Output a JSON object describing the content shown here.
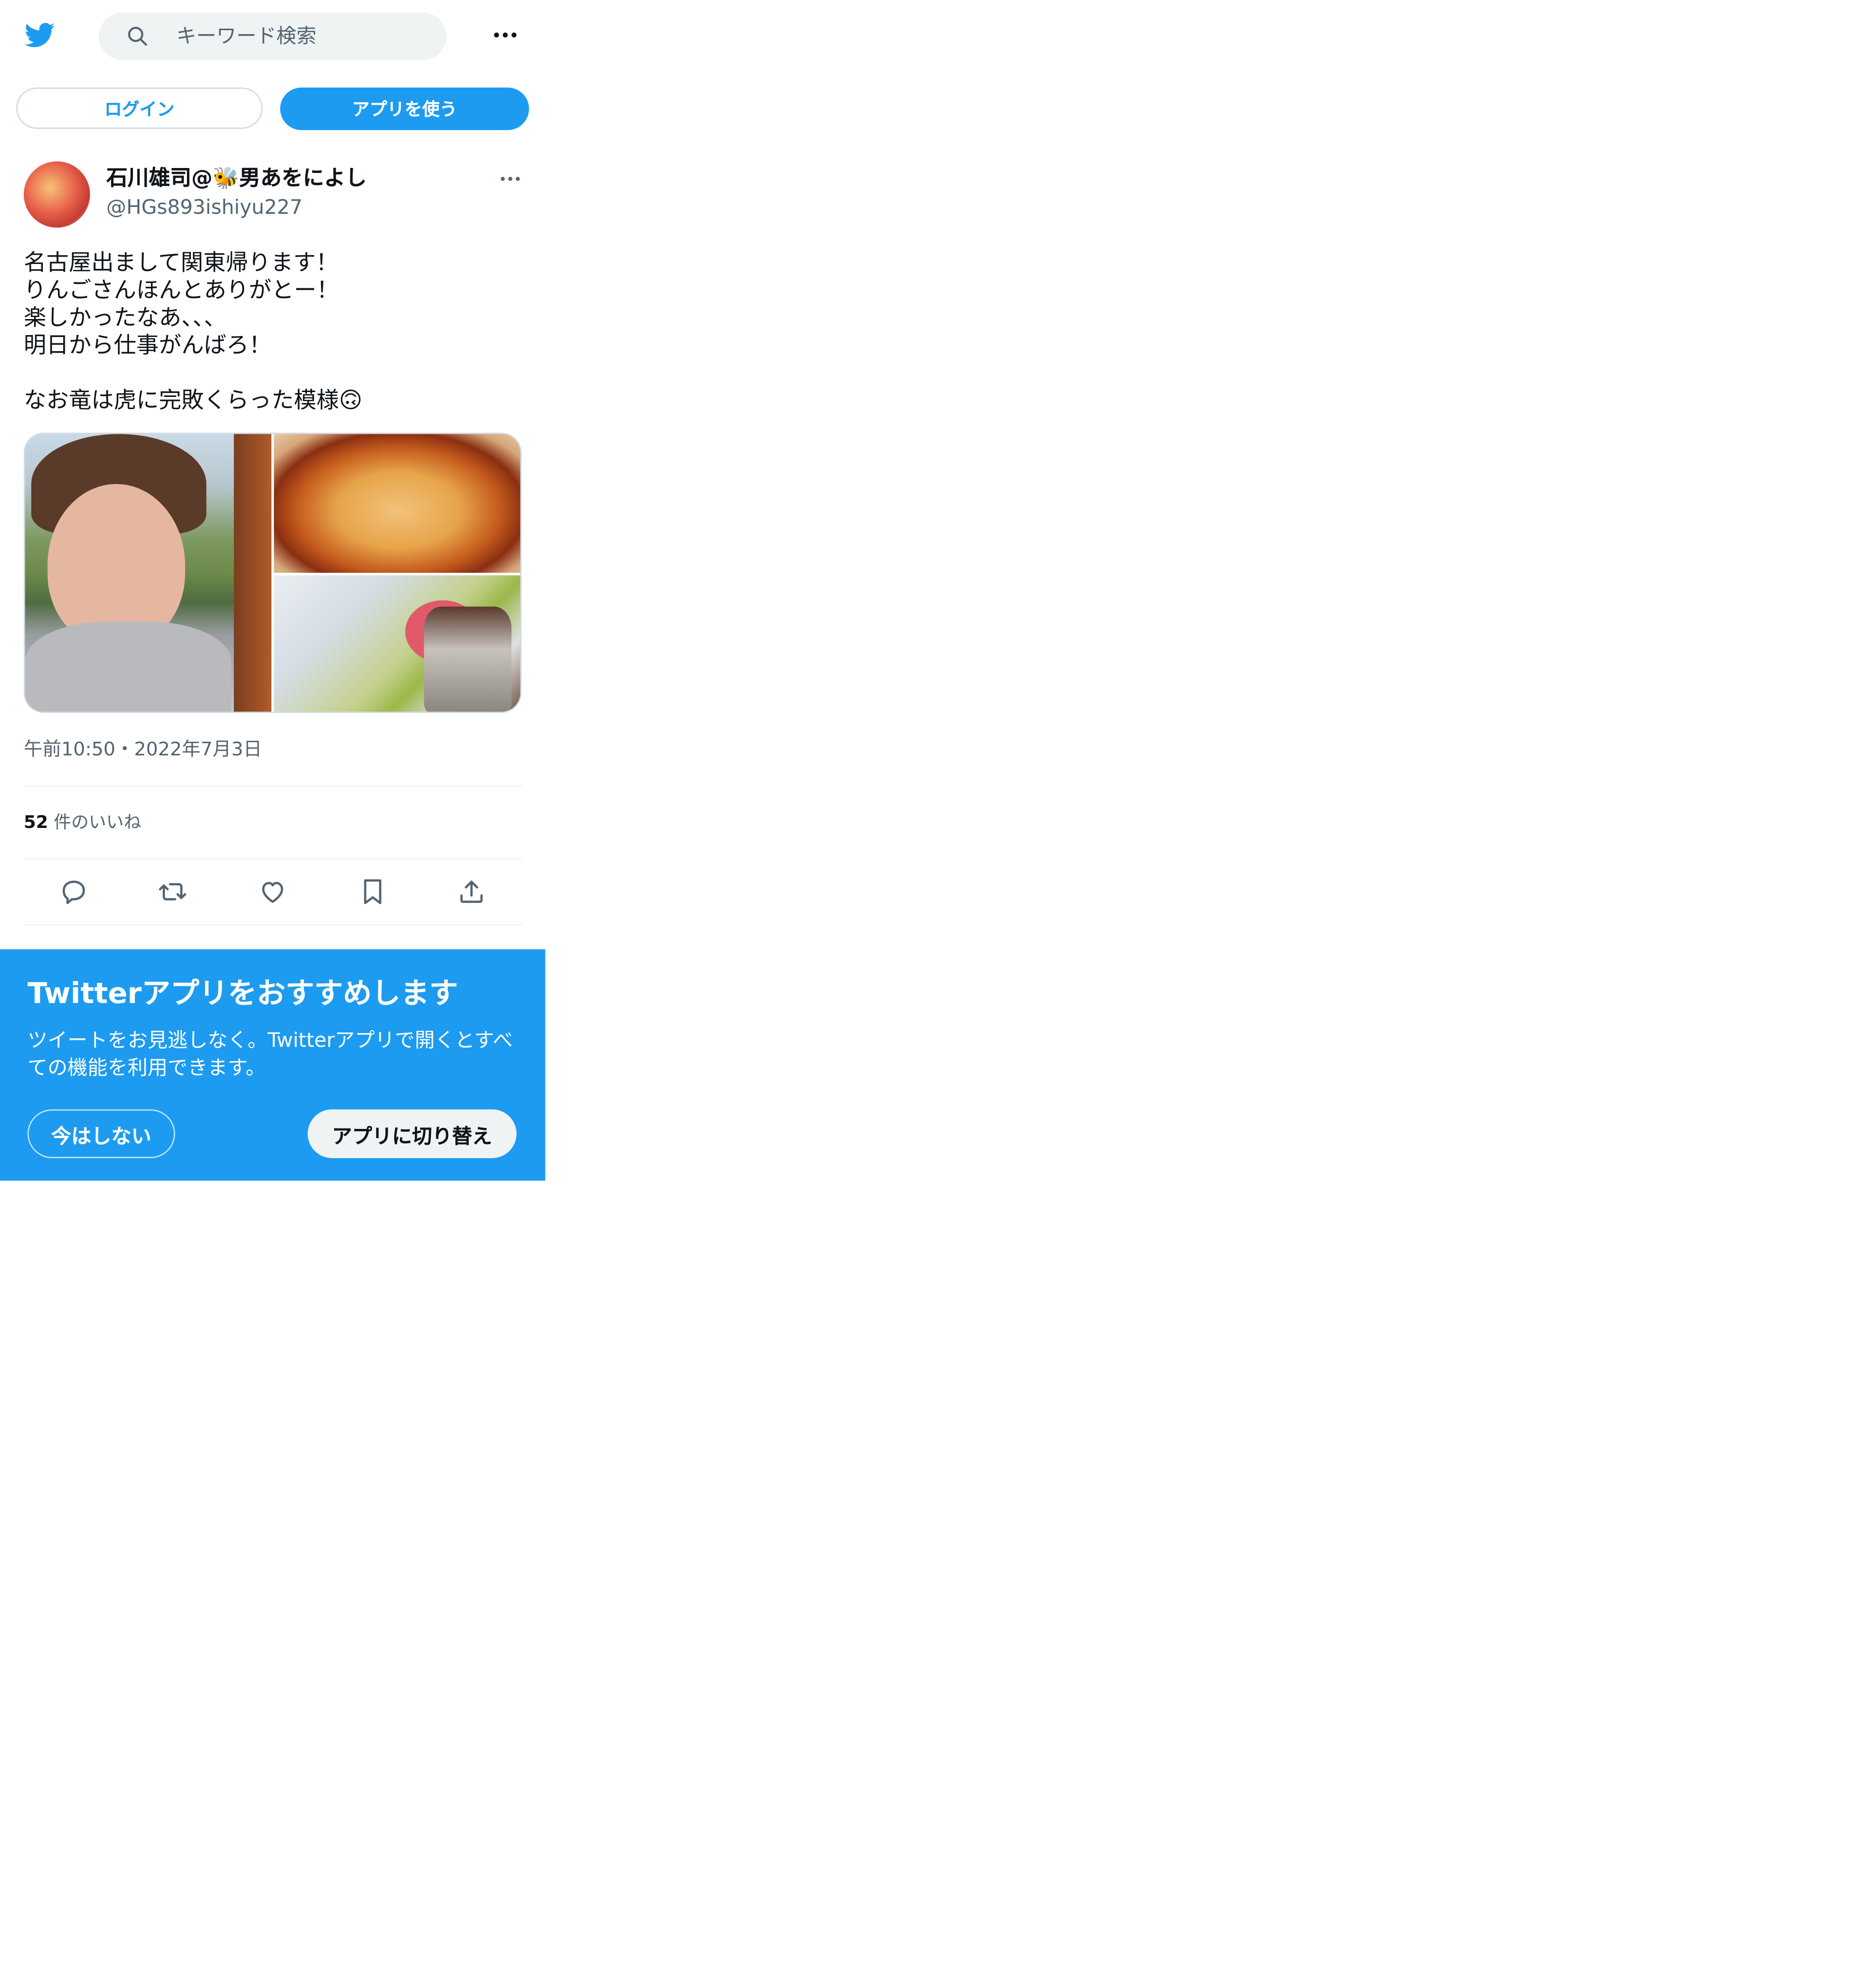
{
  "header": {
    "logo_icon": "twitter-bird-icon",
    "search_placeholder": "キーワード検索",
    "search_icon": "search-icon",
    "more_icon": "more-horizontal-icon"
  },
  "auth": {
    "login_label": "ログイン",
    "use_app_label": "アプリを使う"
  },
  "tweet": {
    "display_name": "石川雄司@🐝男あをによし",
    "handle": "@HGs893ishiyu227",
    "text": "名古屋出まして関東帰ります！\nりんごさんほんとありがとー！\n楽しかったなあ、、、\n明日から仕事がんばろ！\n\nなお竜は虎に完敗くらった模様🙃",
    "timestamp": "午前10:50・2022年7月3日",
    "likes_count": "52",
    "likes_label": "件のいいね",
    "actions": [
      "reply-icon",
      "retweet-icon",
      "like-icon",
      "bookmark-icon",
      "share-icon"
    ]
  },
  "promo": {
    "title": "Twitterアプリをおすすめします",
    "body": "ツイートをお見逃しなく。Twitterアプリで開くとすべての機能を利用できます。",
    "later_label": "今はしない",
    "switch_label": "アプリに切り替え"
  },
  "colors": {
    "brand": "#1d9bf0",
    "text": "#0f1419",
    "secondary": "#536471",
    "search_bg": "#eff3f4"
  }
}
